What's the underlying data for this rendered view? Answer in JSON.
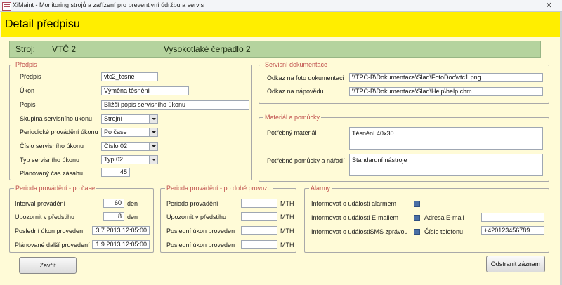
{
  "window": {
    "title": "XiMaint - Monitoring strojů a zařízení pro preventivní údržbu a servis",
    "close_glyph": "✕"
  },
  "header": {
    "title": "Detail předpisu"
  },
  "machine": {
    "label": "Stroj:",
    "code": "VTČ 2",
    "name": "Vysokotlaké čerpadlo 2"
  },
  "predpis": {
    "legend": "Předpis",
    "predpis_label": "Předpis",
    "predpis_value": "vtc2_tesne",
    "ukon_label": "Úkon",
    "ukon_value": "Výměna těsnění",
    "popis_label": "Popis",
    "popis_value": "Bližší popis servisního úkonu",
    "skupina_label": "Skupina servisního úkonu",
    "skupina_value": "Strojní",
    "periodicke_label": "Periodické provádění úkonu",
    "periodicke_value": "Po čase",
    "cislo_label": "Číslo servisního úkonu",
    "cislo_value": "Číslo 02",
    "typ_label": "Typ servisního úkonu",
    "typ_value": "Typ 02",
    "cas_label": "Plánovaný čas zásahu",
    "cas_value": "45"
  },
  "dokumentace": {
    "legend": "Servisní dokumentace",
    "foto_label": "Odkaz na foto dokumentaci",
    "foto_value": "\\\\TPC-B\\Dokumentace\\Slad\\FotoDoc\\vtc1.png",
    "napoveda_label": "Odkaz na nápovědu",
    "napoveda_value": "\\\\TPC-B\\Dokumentace\\Slad\\Help\\help.chm"
  },
  "material": {
    "legend": "Materiál a pomůcky",
    "material_label": "Potřebný materiál",
    "material_value": "Těsnění 40x30",
    "pomucky_label": "Potřebné pomůcky a nářadí",
    "pomucky_value": "Standardní nástroje"
  },
  "perioda_cas": {
    "legend": "Perioda provádění - po čase",
    "interval_label": "Interval provádění",
    "interval_value": "60",
    "interval_unit": "den",
    "upozornit_label": "Upozornit v předstihu",
    "upozornit_value": "8",
    "upozornit_unit": "den",
    "posledni_label": "Poslední úkon proveden",
    "posledni_value": "3.7.2013 12:05:00",
    "planovane_label": "Plánované další provedení",
    "planovane_value": "1.9.2013 12:05:00"
  },
  "perioda_provoz": {
    "legend": "Perioda provádění - po době provozu",
    "perioda_label": "Perioda provádění",
    "perioda_unit": "MTH",
    "upozornit_label": "Upozornit v předstihu",
    "upozornit_unit": "MTH",
    "posledni1_label": "Poslední úkon proveden",
    "posledni1_unit": "MTH",
    "posledni2_label": "Poslední úkon proveden",
    "posledni2_unit": "MTH"
  },
  "alarmy": {
    "legend": "Alarmy",
    "alarm_label": "Informovat o události alarmem",
    "email_label": "Informovat o události E-mailem",
    "sms_label": "Informovat o událostiSMS zprávou",
    "adresa_label": "Adresa E-mail",
    "adresa_value": "",
    "telefon_label": "Číslo telefonu",
    "telefon_value": "+420123456789"
  },
  "buttons": {
    "close": "Zavřít",
    "delete": "Odstranit záznam"
  },
  "colors": {
    "header": "#ffee00",
    "background": "#fffbd7",
    "band": "#b5d39e",
    "legend_text": "#c0504d",
    "checkbox": "#4a6fa5"
  }
}
